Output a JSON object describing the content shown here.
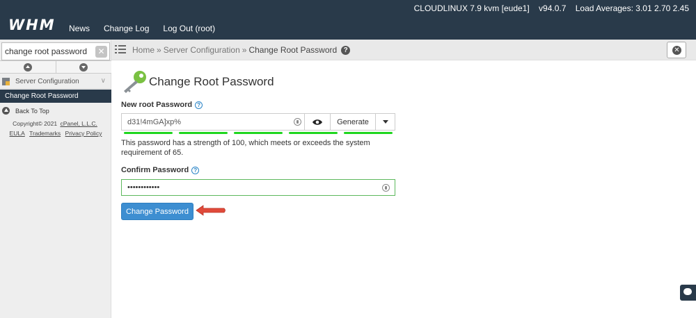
{
  "header": {
    "logo": "WHM",
    "nav": [
      "News",
      "Change Log",
      "Log Out (root)"
    ],
    "sysinfo": {
      "os": "CLOUDLINUX 7.9 kvm [eude1]",
      "version": "v94.0.7",
      "load": "Load Averages: 3.01 2.70 2.45"
    }
  },
  "sidebar": {
    "search_value": "change root password",
    "group_label": "Server Configuration",
    "active_item": "Change Root Password",
    "back_to_top": "Back To Top",
    "copyright": "Copyright© 2021",
    "company_link": "cPanel, L.L.C.",
    "footer_links": [
      "EULA",
      "Trademarks",
      "Privacy Policy"
    ]
  },
  "breadcrumb": {
    "items": [
      "Home",
      "Server Configuration",
      "Change Root Password"
    ],
    "separator": "»"
  },
  "main": {
    "title": "Change Root Password",
    "new_password_label": "New root Password",
    "new_password_value": "d31!4mGA]xp%",
    "generate_label": "Generate",
    "strength_fraction": 1.0,
    "strength_message": "This password has a strength of 100, which meets or exceeds the system requirement of 65.",
    "confirm_label": "Confirm Password",
    "confirm_value": "••••••••••••",
    "submit_label": "Change Password"
  },
  "colors": {
    "header_bg": "#293a4a",
    "primary_button": "#3d8ed1",
    "strength_bar": "#1fd61f",
    "arrow_annotation": "#e04a3a"
  }
}
